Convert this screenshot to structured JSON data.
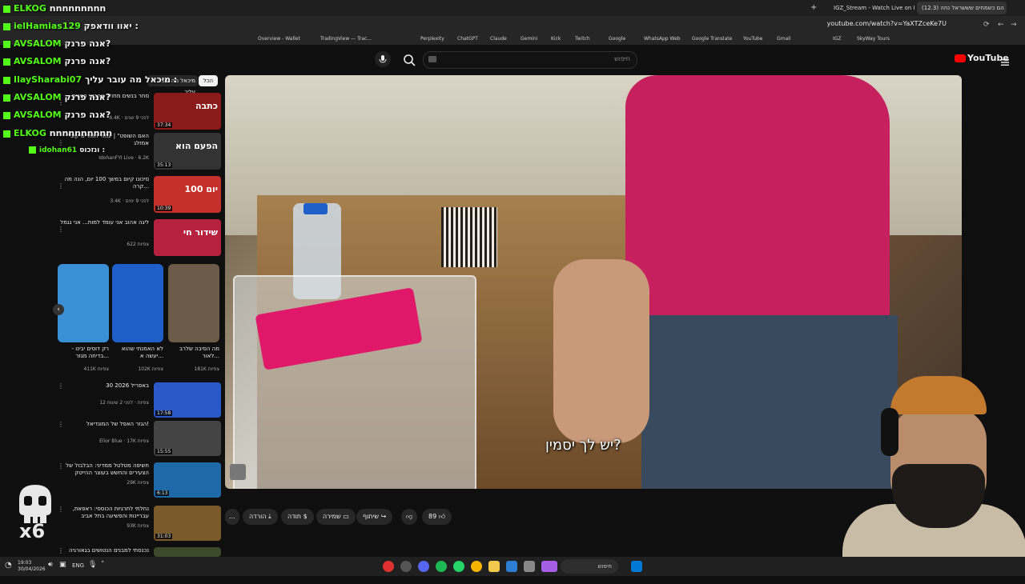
{
  "browser": {
    "tabs": [
      {
        "label": "IGZ_Stream - Watch Live on K"
      },
      {
        "label": "הם כשמחים שששראל נחה (12.3)"
      }
    ],
    "url": "youtube.com/watch?v=YaXTZceKe7U",
    "bookmarks": [
      "Overview - Wallet",
      "TradingView — Trac...",
      "Perplexity",
      "ChatGPT",
      "Claude",
      "Gemini",
      "Kick",
      "Twitch",
      "Google",
      "WhatsApp Web",
      "Google Translate",
      "YouTube",
      "Gmail",
      "IGZ",
      "SkyWay Tours"
    ]
  },
  "youtube": {
    "logo_text": "YouTube",
    "search_placeholder": "חיפוש",
    "chips": {
      "all": "הכל",
      "mahmud": "מיכאל מה עובר עליך"
    }
  },
  "video": {
    "subtitle": "יש לך יסמין?",
    "actions": {
      "likes": "89",
      "share": "שיתוף",
      "save": "שמירה",
      "thanks": "תודה",
      "download": "הורדה",
      "more": "..."
    }
  },
  "sidebar": {
    "recs": [
      {
        "title": "סחר בנשים מחוזר אהבשי הנשים",
        "meta": "8.4K · לפני 9 שנים",
        "duration": "37:34",
        "thumb_text": "כתבה"
      },
      {
        "title": "\"האם השופט\" | עמוד המורים קובי אמזלג",
        "meta": "IdohanFYI Live · 6.2K",
        "duration": "35:13",
        "thumb_text": "הפעם הוא"
      },
      {
        "title": "סיכונו קיום במשך 100 יום, הנה מה קרה...",
        "meta": "3.4K · לפני 9 ימים",
        "duration": "10:39",
        "thumb_text": "יום 100"
      },
      {
        "title": "ליגה אהוב אני עומד למות... אני נגמל",
        "meta": "622 צפיות",
        "duration": "",
        "thumb_text": "שידור חי"
      }
    ],
    "shorts": [
      {
        "title": "מה הסיבה שלרב לאור...",
        "views": "181K צפיות"
      },
      {
        "title": "לא האמנתי שהוא יעשה א...",
        "views": "102K צפיות"
      },
      {
        "title": "רק דוסים יבינו - בדיחה מגזר...",
        "views": "411K צפיות"
      }
    ],
    "recs2": [
      {
        "title": "30 באפריל 2026",
        "meta": "12 צפיות · לפני 2 שעות",
        "duration": "17:58"
      },
      {
        "title": "הגזר האפל של המונדיאל!",
        "meta": "Elior Blue · 17K צפיות",
        "duration": "15:55"
      },
      {
        "title": "חשיפה מטלטל ממדיני: הבלבול של הצעירים והחשש בעוצר ההייטק",
        "meta": "29K צפיות",
        "duration": "6:13"
      },
      {
        "title": "נחלתי לתרגיות הכוססי: ראפאת, עבריינות והפשיעה בתל אביב",
        "meta": "93K צפיות",
        "duration": "31:03"
      },
      {
        "title": "נכנסתי למבנים הנטושים בגאורגיה",
        "meta": "",
        "duration": ""
      }
    ]
  },
  "chat": [
    {
      "user": "ELKOG",
      "text": "nnnnnnnnn"
    },
    {
      "user": "ielHamias129",
      "text": "יאוו וודאפק :"
    },
    {
      "user": "AVSALOM",
      "text": "אנה פרנק?"
    },
    {
      "user": "AVSALOM",
      "text": "אנה פרנק?"
    },
    {
      "user": "IlaySharabi07",
      "text": "מיכאל מה עובר עליך :"
    },
    {
      "user": "AVSALOM",
      "text": "אנה פרנק?"
    },
    {
      "user": "AVSALOM",
      "text": "אנה פרנק?"
    },
    {
      "user": "ELKOG",
      "text": "nnnnnnnnnn"
    },
    {
      "user": "idohan61",
      "text": "ונזכוס :"
    }
  ],
  "overlay": {
    "x6": "x6"
  },
  "taskbar": {
    "time": "19:03",
    "date": "30/04/2026",
    "lang": "ENG",
    "search": "חיפוש"
  },
  "colors": {
    "kick_green": "#53fc18",
    "yt_red": "#ff0000"
  }
}
